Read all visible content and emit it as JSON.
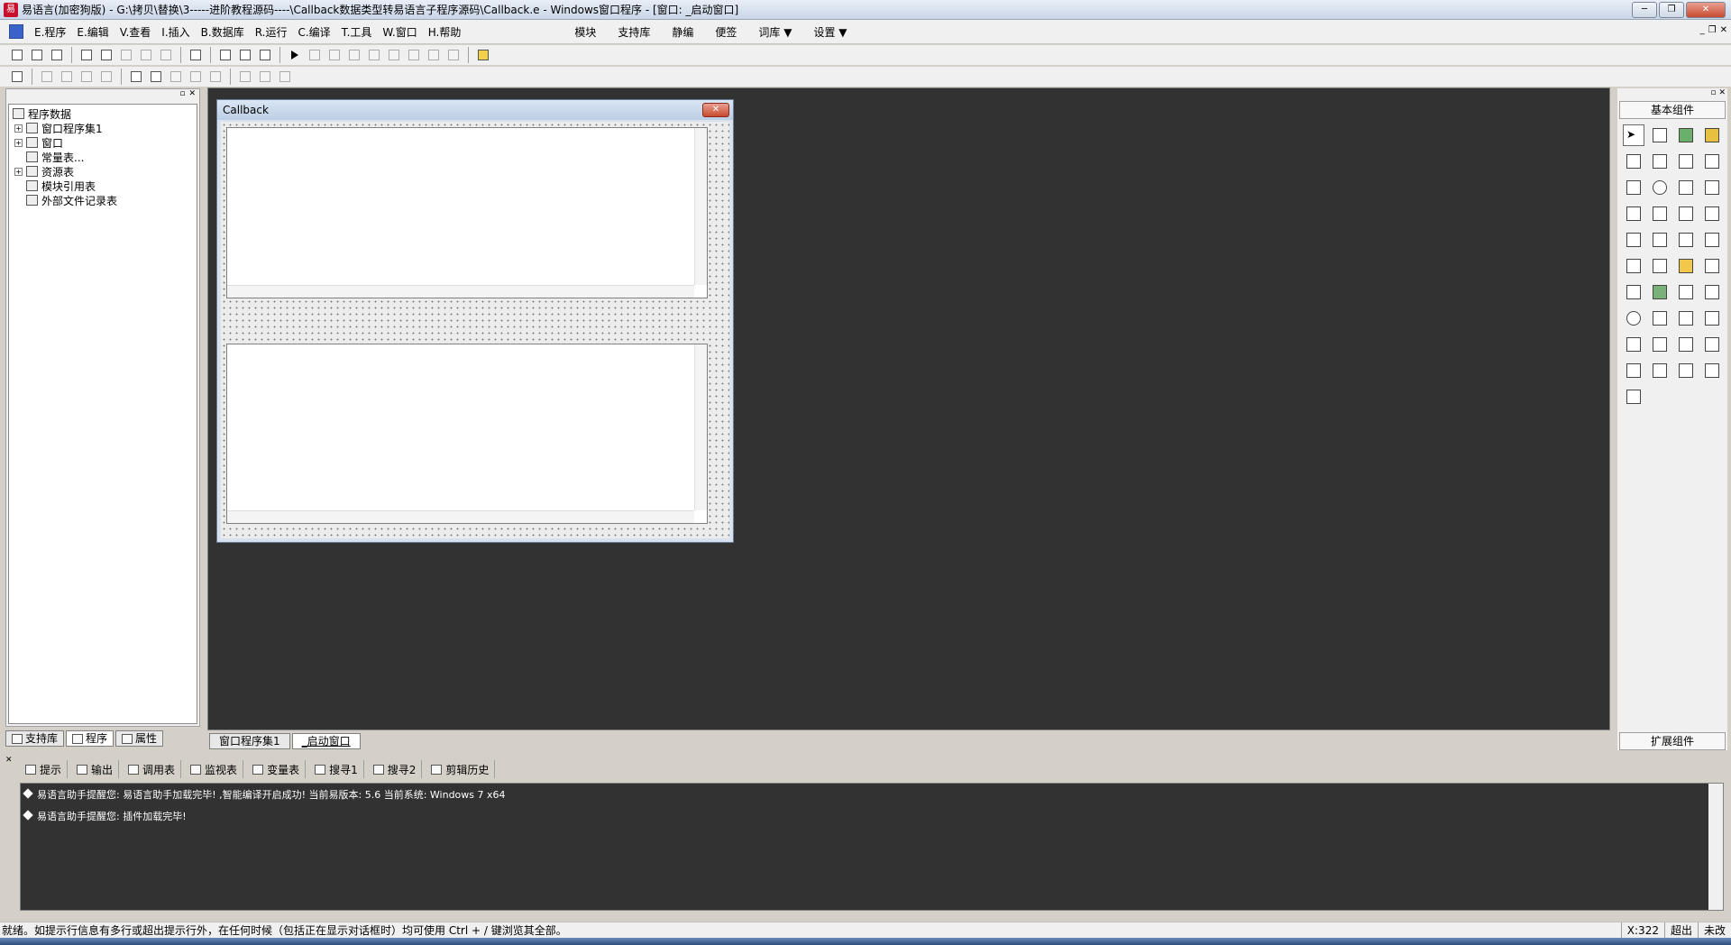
{
  "window": {
    "title": "易语言(加密狗版) - G:\\拷贝\\替换\\3-----进阶教程源码----\\Callback数据类型转易语言子程序源码\\Callback.e - Windows窗口程序 - [窗口: _启动窗口]",
    "minimize": "─",
    "restore": "❐",
    "close": "✕"
  },
  "menu": {
    "items": [
      "E.程序",
      "E.编辑",
      "V.查看",
      "I.插入",
      "B.数据库",
      "R.运行",
      "C.编译",
      "T.工具",
      "W.窗口",
      "H.帮助"
    ],
    "right_items": [
      "模块",
      "支持库",
      "静编",
      "便签",
      "词库 ▼",
      "设置 ▼"
    ],
    "mdi_min": "_",
    "mdi_restore": "❐",
    "mdi_close": "✕"
  },
  "tree": {
    "root": "程序数据",
    "items": [
      "窗口程序集1",
      "窗口",
      "常量表...",
      "资源表",
      "模块引用表",
      "外部文件记录表"
    ]
  },
  "left_tabs": [
    "支持库",
    "程序",
    "属性"
  ],
  "design_window": {
    "title": "Callback",
    "close": "✕"
  },
  "doc_tabs": [
    "窗口程序集1",
    "_启动窗口"
  ],
  "palette": {
    "title": "基本组件",
    "ext": "扩展组件"
  },
  "output_tabs": [
    "提示",
    "输出",
    "调用表",
    "监视表",
    "变量表",
    "搜寻1",
    "搜寻2",
    "剪辑历史"
  ],
  "output_lines": [
    "易语言助手提醒您: 易语言助手加载完毕! ,智能编译开启成功! 当前易版本: 5.6 当前系统: Windows 7 x64",
    "易语言助手提醒您: 插件加载完毕!"
  ],
  "status": {
    "text": "就绪。如提示行信息有多行或超出提示行外，在任何时候（包括正在显示对话框时）均可使用 Ctrl + / 键浏览其全部。",
    "coord": "X:322",
    "mode": "超出",
    "modified": "未改"
  }
}
